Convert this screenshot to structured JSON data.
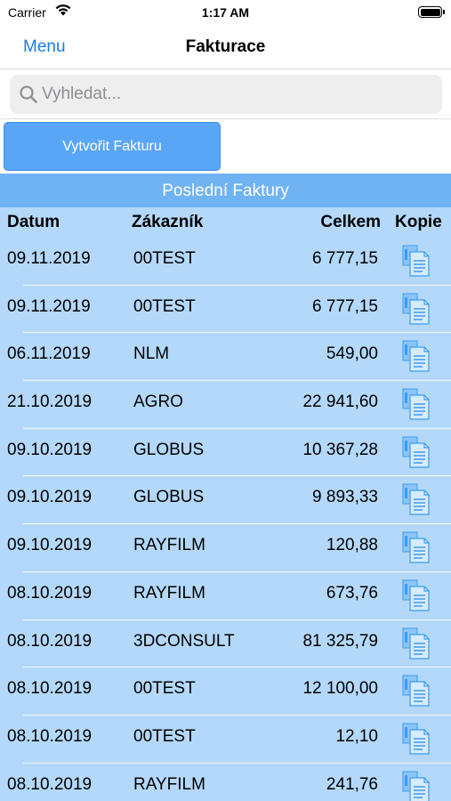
{
  "status_bar": {
    "carrier": "Carrier",
    "time": "1:17 AM"
  },
  "nav": {
    "menu_label": "Menu",
    "title": "Fakturace"
  },
  "search": {
    "placeholder": "Vyhledat...",
    "value": ""
  },
  "actions": {
    "create_label": "Vytvořit Fakturu"
  },
  "invoices": {
    "section_title": "Poslední Faktury",
    "columns": {
      "date": "Datum",
      "customer": "Zákazník",
      "total": "Celkem",
      "copy": "Kopie"
    },
    "rows": [
      {
        "date": "09.11.2019",
        "customer": "00TEST",
        "total": "6 777,15"
      },
      {
        "date": "09.11.2019",
        "customer": "00TEST",
        "total": "6 777,15"
      },
      {
        "date": "06.11.2019",
        "customer": "NLM",
        "total": "549,00"
      },
      {
        "date": "21.10.2019",
        "customer": "AGRO",
        "total": "22 941,60"
      },
      {
        "date": "09.10.2019",
        "customer": "GLOBUS",
        "total": "10 367,28"
      },
      {
        "date": "09.10.2019",
        "customer": "GLOBUS",
        "total": "9 893,33"
      },
      {
        "date": "09.10.2019",
        "customer": "RAYFILM",
        "total": "120,88"
      },
      {
        "date": "08.10.2019",
        "customer": "RAYFILM",
        "total": "673,76"
      },
      {
        "date": "08.10.2019",
        "customer": "3DCONSULT",
        "total": "81 325,79"
      },
      {
        "date": "08.10.2019",
        "customer": "00TEST",
        "total": "12 100,00"
      },
      {
        "date": "08.10.2019",
        "customer": "00TEST",
        "total": "12,10"
      },
      {
        "date": "08.10.2019",
        "customer": "RAYFILM",
        "total": "241,76"
      }
    ]
  },
  "colors": {
    "accent": "#1a7bea",
    "button": "#5aa6f6",
    "header": "#6fb3f2",
    "panel": "#b3d8fa",
    "icon": "#3d9bf0"
  },
  "icons": {
    "search": "search-icon",
    "copy": "document-copy-icon",
    "wifi": "wifi-icon",
    "battery": "battery-icon"
  }
}
